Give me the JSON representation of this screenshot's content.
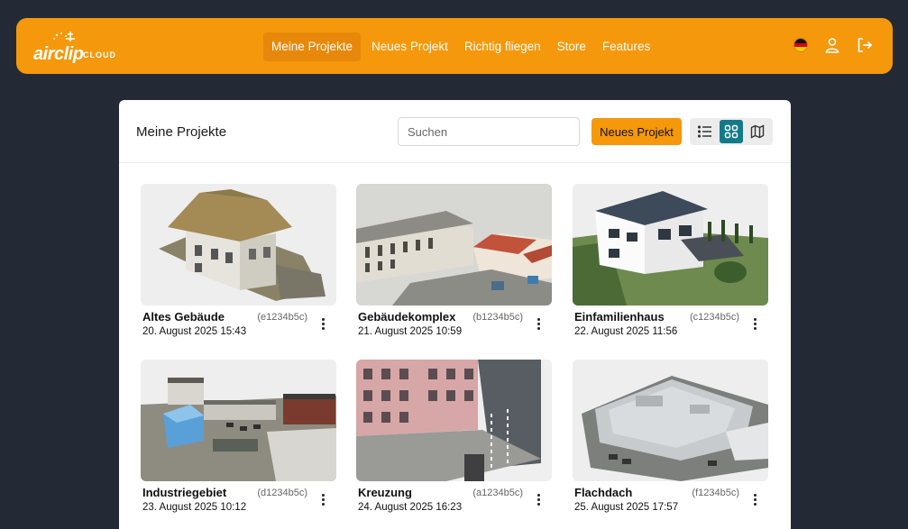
{
  "brand": {
    "name": "airclip",
    "suffix": "CLOUD"
  },
  "nav": [
    {
      "label": "Meine Projekte",
      "active": true
    },
    {
      "label": "Neues Projekt",
      "active": false
    },
    {
      "label": "Richtig fliegen",
      "active": false
    },
    {
      "label": "Store",
      "active": false
    },
    {
      "label": "Features",
      "active": false
    }
  ],
  "header_icons": [
    "german-flag-icon",
    "user-icon",
    "logout-icon"
  ],
  "page": {
    "title": "Meine Projekte",
    "search_placeholder": "Suchen",
    "new_project_label": "Neues Projekt",
    "views": [
      "list-view-icon",
      "grid-view-icon",
      "map-view-icon"
    ],
    "active_view": "grid-view-icon"
  },
  "colors": {
    "accent": "#f5980b",
    "background": "#232a35",
    "view_active": "#137a8a"
  },
  "projects": [
    {
      "name": "Altes Gebäude",
      "id": "(e1234b5c)",
      "date": "20. August 2025 15:43"
    },
    {
      "name": "Gebäudekomplex",
      "id": "(b1234b5c)",
      "date": "21. August 2025 10:59"
    },
    {
      "name": "Einfamilienhaus",
      "id": "(c1234b5c)",
      "date": "22. August 2025 11:56"
    },
    {
      "name": "Industriegebiet",
      "id": "(d1234b5c)",
      "date": "23. August 2025 10:12"
    },
    {
      "name": "Kreuzung",
      "id": "(a1234b5c)",
      "date": "24. August 2025 16:23"
    },
    {
      "name": "Flachdach",
      "id": "(f1234b5c)",
      "date": "25. August 2025 17:57"
    }
  ]
}
